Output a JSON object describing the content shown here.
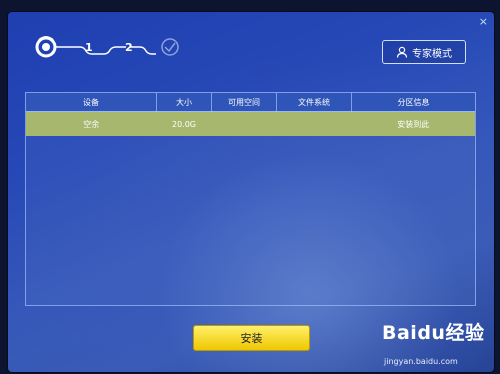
{
  "window": {
    "close_label": "×"
  },
  "steps": {
    "step1": "1",
    "step2": "2"
  },
  "expert_mode": {
    "label": "专家模式",
    "icon": "user-icon"
  },
  "table": {
    "headers": [
      "设备",
      "大小",
      "可用空间",
      "文件系统",
      "分区信息"
    ],
    "rows": [
      [
        "空余",
        "20.0G",
        "",
        "",
        "安装到此"
      ]
    ]
  },
  "install_button": {
    "label": "安装"
  },
  "watermark": {
    "brand": "Baidu经验",
    "url": "jingyan.baidu.com"
  },
  "colors": {
    "selected_row": "#a8b76e",
    "header": "#2f55b8",
    "install_button": "#f5d500"
  }
}
